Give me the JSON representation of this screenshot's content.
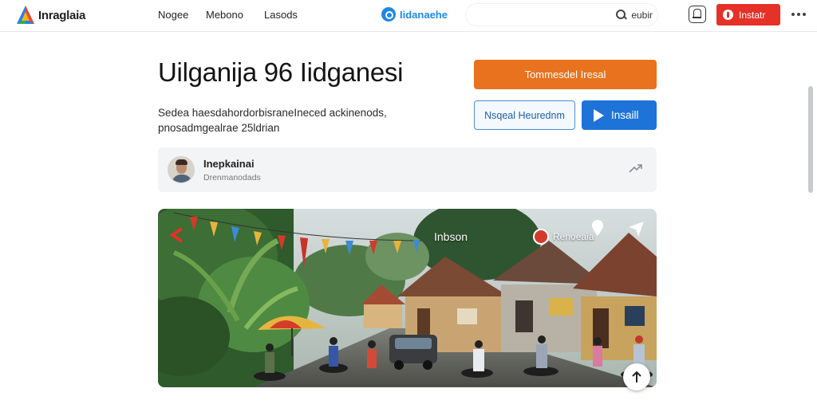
{
  "header": {
    "logo_text": "Inraglaia",
    "nav": [
      "Nogee",
      "Mebono",
      "Lasods"
    ],
    "brand_badge": "Iidanaehe",
    "search_placeholder": "eubir",
    "install_label": "Instatr",
    "icons": [
      "search-icon",
      "bell-icon",
      "more-icon"
    ]
  },
  "hero": {
    "title": "Uilganija 96 Iidganesi",
    "description": "Sedea haesdahordorbisraneIneced ackinenods, pnosadmgealrae 25ldrian",
    "primary_cta": "Tommesdel Iresal",
    "secondary_cta": "Nsqeal Heurednm",
    "install_cta": "Insaill"
  },
  "author": {
    "name": "Inepkainai",
    "subtitle": "Drenmanodads"
  },
  "image": {
    "label_left": "Inbson",
    "tag_label": "Renoeaia",
    "colors": {
      "accent_orange": "#e8721e",
      "accent_blue": "#1e73d8",
      "accent_red": "#e53127"
    }
  }
}
